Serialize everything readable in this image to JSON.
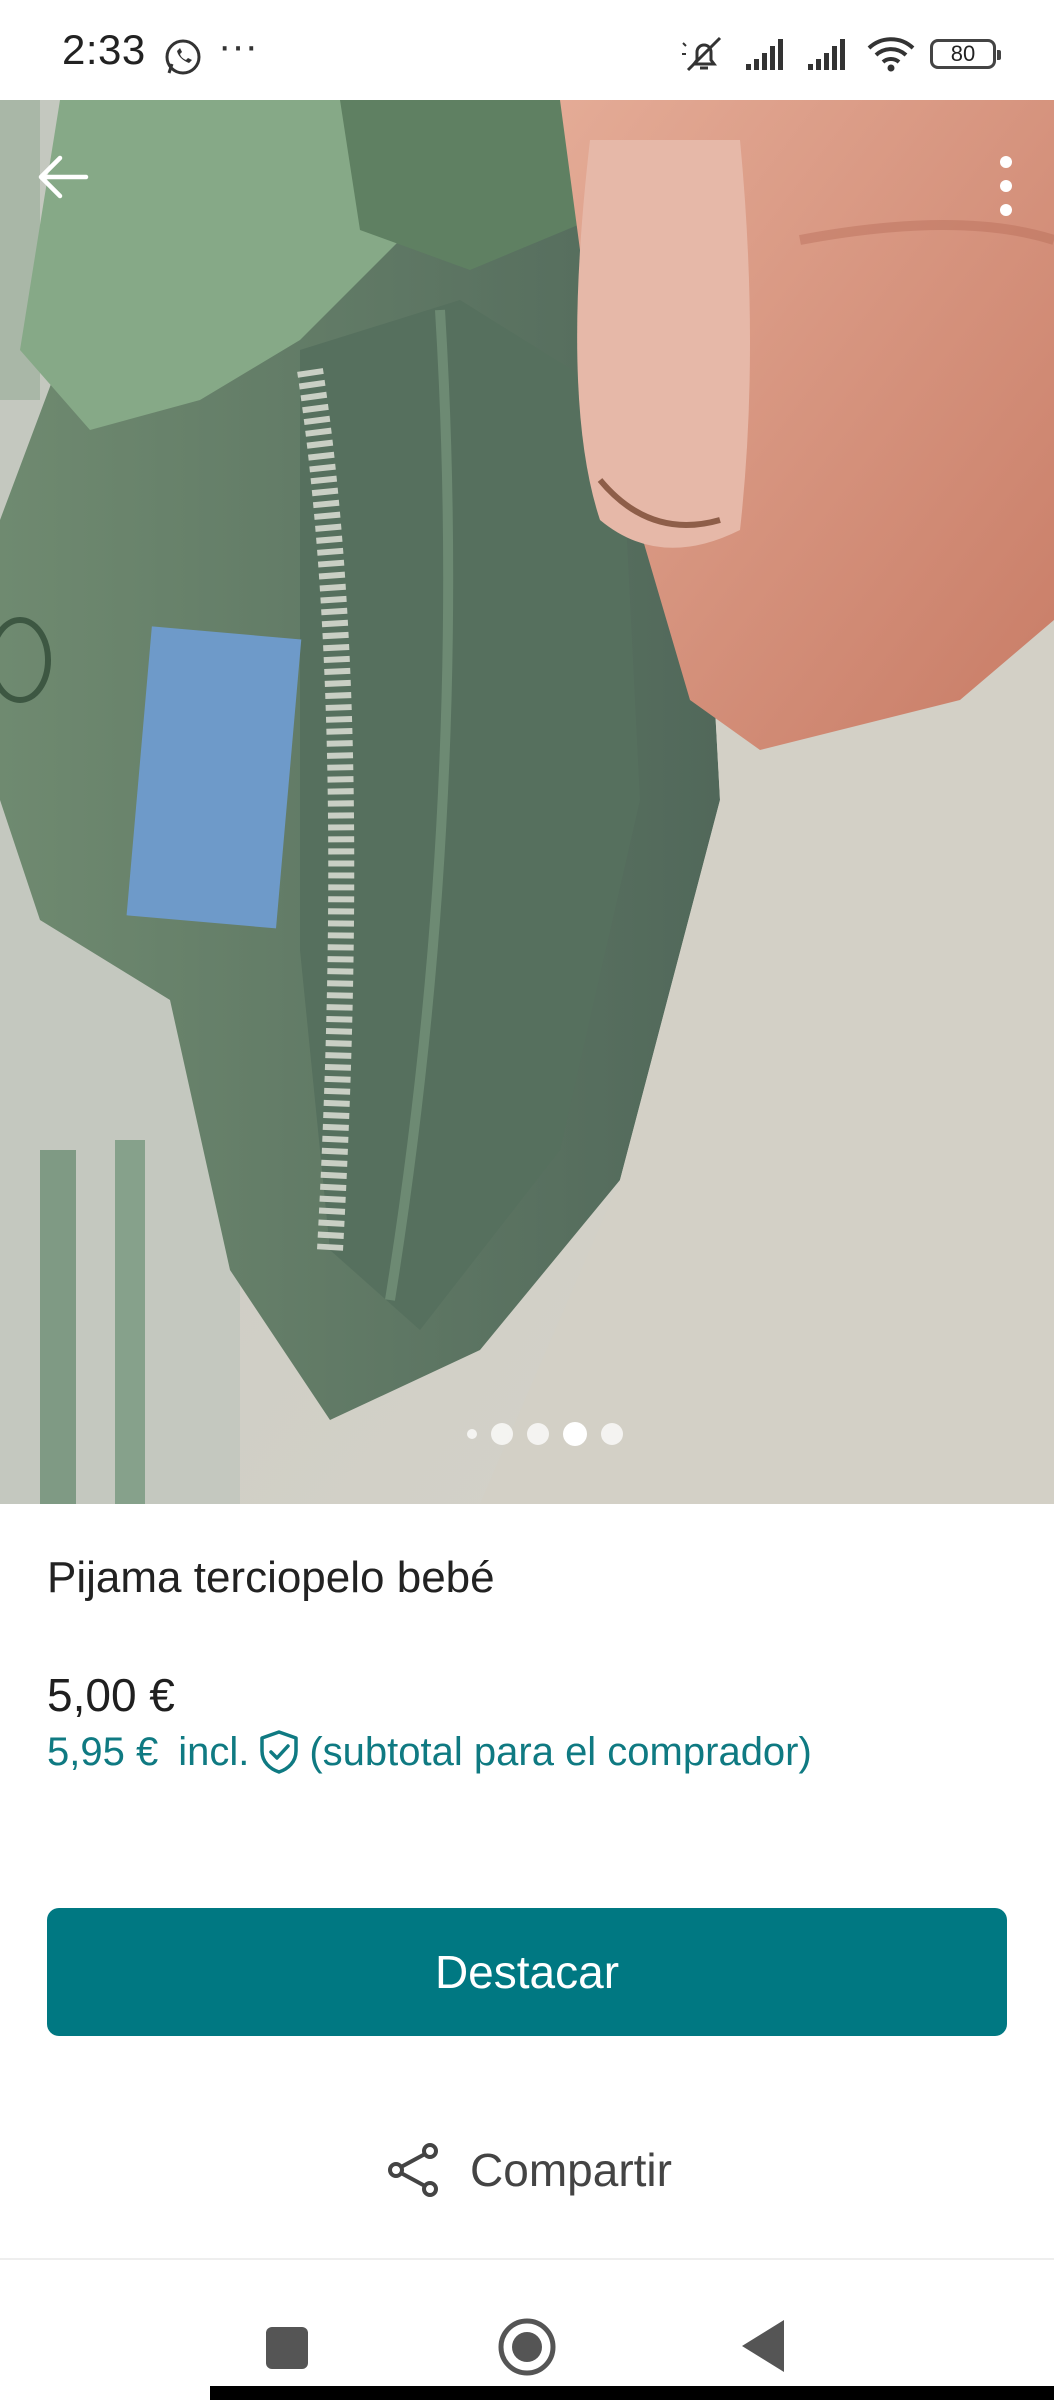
{
  "status_bar": {
    "time": "2:33",
    "more": "···",
    "battery": "80",
    "icons": [
      "whatsapp-icon",
      "mute-icon",
      "signal-icon",
      "signal-icon",
      "wifi-icon",
      "battery-icon"
    ]
  },
  "gallery": {
    "page_count": 5,
    "active_index": 3
  },
  "product": {
    "title": "Pijama terciopelo bebé",
    "price": "5,00 €",
    "total_amount": "5,95 €",
    "total_incl": "incl.",
    "total_note": "(subtotal para el comprador)"
  },
  "actions": {
    "primary_label": "Destacar",
    "share_label": "Compartir"
  },
  "colors": {
    "accent": "#007882",
    "accent_text": "#0f7a82"
  }
}
